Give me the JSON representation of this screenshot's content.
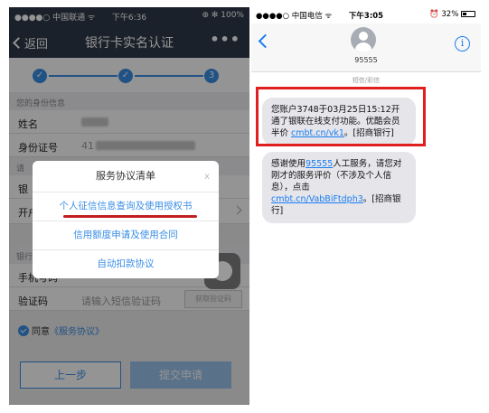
{
  "left_phone": {
    "status": {
      "carrier": "●●●●○ 中国联通 ᯤ",
      "time": "下午6:36",
      "right": "⊕ ✻ 100%"
    },
    "nav": {
      "back_label": "返回",
      "title": "银行卡实名认证",
      "more": "•••"
    },
    "steps": {
      "step3": "3"
    },
    "identity_section": "您的身份信息",
    "name_label": "姓名",
    "id_label": "身份证号",
    "id_value_prefix": "41",
    "card_section": "请",
    "card_row_label": "银",
    "bank_row_label": "开户",
    "phone_section": "银行",
    "phone_label": "手机号码",
    "code_label": "验证码",
    "code_placeholder": "请输入短信验证码",
    "code_button": "获取验证码",
    "agree_text": "同意",
    "agree_link": "《服务协议》",
    "prev_button": "上一步",
    "submit_button": "提交申请",
    "modal": {
      "title": "服务协议清单",
      "close": "x",
      "items": [
        "个人征信信息查询及使用授权书",
        "信用额度申请及使用合同",
        "自动扣款协议"
      ]
    }
  },
  "right_phone": {
    "status": {
      "carrier": "●●●●○ 中国电信 ᯤ",
      "time": "下午3:05",
      "right": "⏰ 32%"
    },
    "contact": "95555",
    "info_icon": "i",
    "meta": "短信/彩信",
    "message1": {
      "part1": "您账户3748于03月25日15:12开通了银联在线支付功能。优酷会员半价 ",
      "link": "cmbt.cn/vk1",
      "part2": "。[招商银行]"
    },
    "message2": {
      "part1": "感谢使用",
      "link1": "95555",
      "part2": "人工服务，请您对刚才的服务评价（不涉及个人信息），点击 ",
      "link2": "cmbt.cn/VabBiFtdph3",
      "part3": "。[招商银行]"
    },
    "colors": {
      "highlight": "#e02020",
      "link": "#1a7ef2"
    }
  }
}
